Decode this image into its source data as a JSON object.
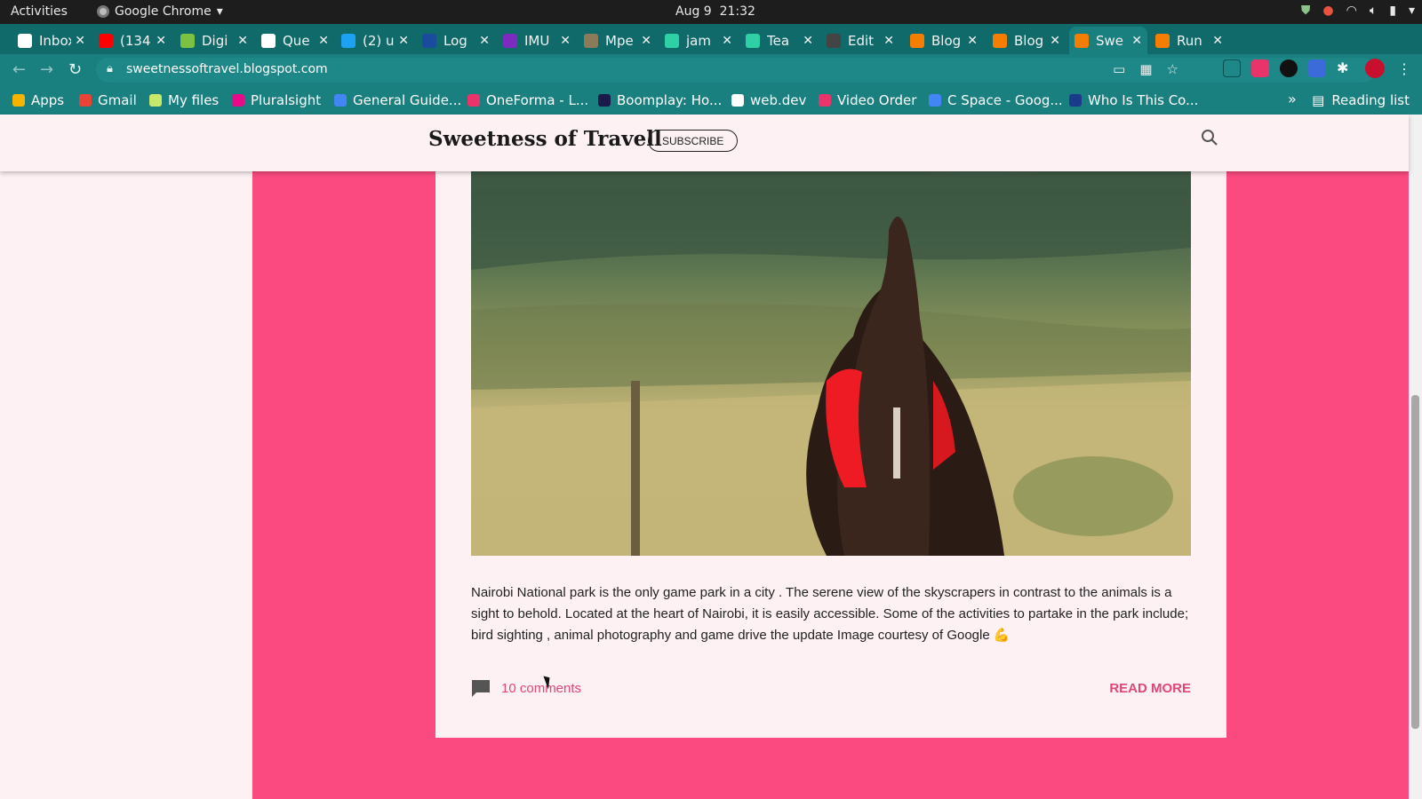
{
  "system_bar": {
    "activities": "Activities",
    "app_name": "Google Chrome",
    "date": "Aug 9",
    "time": "21:32"
  },
  "tabs": [
    {
      "title": "Inbox",
      "favicon": "gmail-icon",
      "color": "#ffffff"
    },
    {
      "title": "(134",
      "favicon": "youtube-icon",
      "color": "#ff0000"
    },
    {
      "title": "Digi",
      "favicon": "digi-icon",
      "color": "#7cc242"
    },
    {
      "title": "Que",
      "favicon": "que-icon",
      "color": "#ffffff"
    },
    {
      "title": "(2) u",
      "favicon": "twitter-icon",
      "color": "#1da1f2"
    },
    {
      "title": "Log",
      "favicon": "paypal-icon",
      "color": "#1a4b9c"
    },
    {
      "title": "IMU",
      "favicon": "list-icon",
      "color": "#7b2cbf"
    },
    {
      "title": "Mpe",
      "favicon": "image-icon",
      "color": "#8c7b5a"
    },
    {
      "title": "jam",
      "favicon": "diamond-icon",
      "color": "#2fd0a5"
    },
    {
      "title": "Tea",
      "favicon": "diamond-icon",
      "color": "#2fd0a5"
    },
    {
      "title": "Edit",
      "favicon": "loading-icon",
      "color": "#444444"
    },
    {
      "title": "Blog",
      "favicon": "blogger-icon",
      "color": "#f57d00"
    },
    {
      "title": "Blog",
      "favicon": "blogger-icon",
      "color": "#f57d00"
    },
    {
      "title": "Swe",
      "favicon": "blogger-icon",
      "color": "#f57d00"
    },
    {
      "title": "Run",
      "favicon": "blogger-icon",
      "color": "#f57d00"
    }
  ],
  "active_tab_index": 13,
  "address_bar": {
    "url": "sweetnessoftravel.blogspot.com"
  },
  "bookmarks": [
    {
      "label": "Apps",
      "icon": "apps-grid-icon",
      "color": "#f4b400"
    },
    {
      "label": "Gmail",
      "icon": "gmail-icon",
      "color": "#ea4335"
    },
    {
      "label": "My files",
      "icon": "yellow-y-icon",
      "color": "#c7e86b"
    },
    {
      "label": "Pluralsight",
      "icon": "pluralsight-icon",
      "color": "#e80a89"
    },
    {
      "label": "General Guide...",
      "icon": "docs-icon",
      "color": "#4285f4"
    },
    {
      "label": "OneForma - L...",
      "icon": "oneforma-icon",
      "color": "#e8336b"
    },
    {
      "label": "Boomplay: Ho...",
      "icon": "boomplay-icon",
      "color": "#1b1b4b"
    },
    {
      "label": "web.dev",
      "icon": "webdev-icon",
      "color": "#ffffff"
    },
    {
      "label": "Video Order",
      "icon": "heart-icon",
      "color": "#e8336b"
    },
    {
      "label": "C Space - Goog...",
      "icon": "cspace-icon",
      "color": "#4285f4"
    },
    {
      "label": "Who Is This Co...",
      "icon": "s-icon",
      "color": "#1a3a8a"
    }
  ],
  "reading_list": "Reading list",
  "blog": {
    "title": "Sweetness of Travell",
    "subscribe": "SUBSCRIBE"
  },
  "post": {
    "body": "  Nairobi National park is the only game park in a city . The serene view of the skyscrapers in contrast to the animals is a sight to behold. Located at the heart of Nairobi, it is easily accessible. Some of the activities to partake in the park include; bird sighting , animal photography and game drive the update Image courtesy of Google 💪",
    "comments": "10 comments",
    "read_more": "READ MORE"
  },
  "colors": {
    "chrome_teal": "#197f7f",
    "page_pink": "#fb4a7f",
    "accent_pink": "#e04677",
    "page_bg": "#fdf1f3"
  }
}
